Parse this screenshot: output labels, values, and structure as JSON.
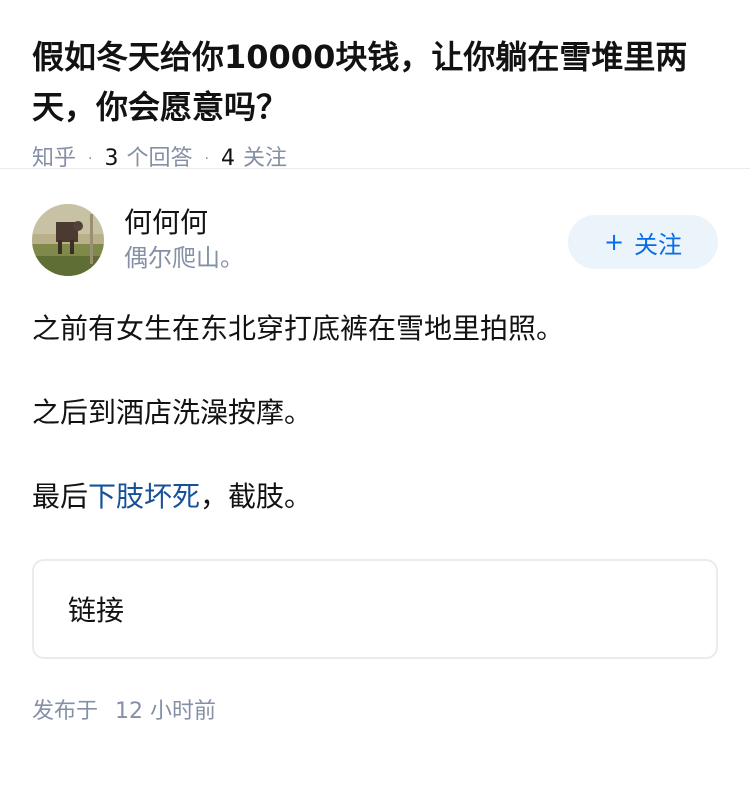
{
  "question": {
    "title": "假如冬天给你10000块钱，让你躺在雪堆里两天，你会愿意吗？",
    "source": "知乎",
    "answer_count": "3",
    "answer_label": "个回答",
    "follow_count": "4",
    "follow_label": "关注"
  },
  "author": {
    "name": "何何何",
    "bio": "偶尔爬山。",
    "follow_button_plus": "+",
    "follow_button_label": "关注"
  },
  "content": {
    "para1": "之前有女生在东北穿打底裤在雪地里拍照。",
    "para2": "之后到酒店洗澡按摩。",
    "para3_prefix": "最后",
    "para3_link": "下肢坏死",
    "para3_suffix": "，截肢。",
    "link_card_label": "链接"
  },
  "footer": {
    "published_prefix": "发布于",
    "published_time": "12 小时前"
  },
  "colors": {
    "accent": "#056de8",
    "link": "#175199",
    "muted": "#8590a6",
    "follow_bg": "#ebf3fb"
  }
}
